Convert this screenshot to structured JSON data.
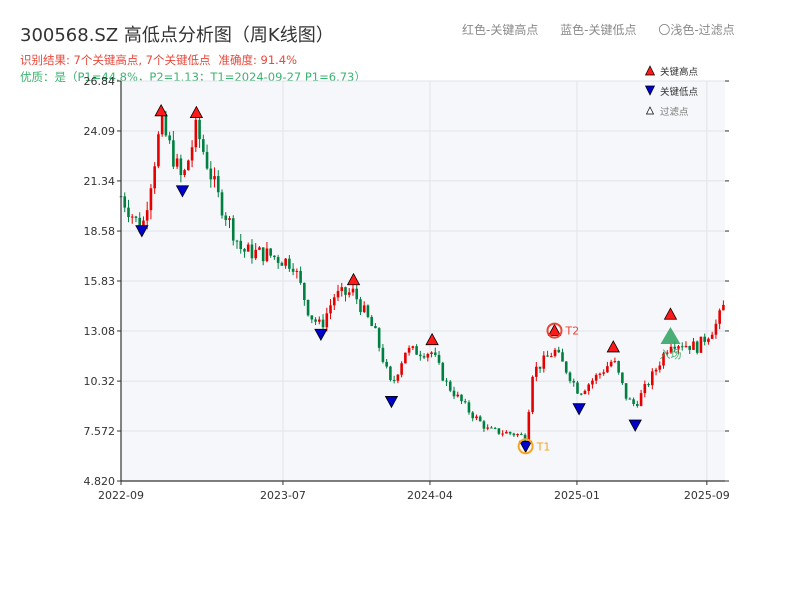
{
  "header": {
    "title": "300568.SZ 高低点分析图（周K线图）",
    "legend_red": "红色-关键高点",
    "legend_blue": "蓝色-关键低点",
    "legend_light": "〇浅色-过滤点",
    "result_text": "识别结果: 7个关键高点, 7个关键低点",
    "accuracy_text": "准确度: 91.4%",
    "quality_text": "优质：是（P1=44.8%，P2=1.13；T1=2024-09-27 P1=6.73）"
  },
  "chart_legend": {
    "high": "关键高点",
    "low": "关键低点",
    "filtered": "过滤点"
  },
  "colors": {
    "up_candle": "#e60000",
    "down_candle": "#008040",
    "high_marker": "#ff1a1a",
    "low_marker": "#0000cc",
    "t1": "#f5a623",
    "t2": "#e8473a",
    "entry": "#2ca25f",
    "plot_bg": "#f5f7fa",
    "grid": "#e0e3e8"
  },
  "chart_data": {
    "type": "candlestick",
    "title": "300568.SZ 高低点分析图（周K线图）",
    "y_ticks": [
      "4.820",
      "7.572",
      "10.32",
      "13.08",
      "15.83",
      "18.58",
      "21.34",
      "24.09",
      "26.84"
    ],
    "ylim": [
      4.82,
      26.84
    ],
    "x_ticks": [
      "2022-09",
      "2023-07",
      "2024-04",
      "2025-01",
      "2025-09"
    ],
    "x_range": [
      "2022-09-01",
      "2025-10-05"
    ],
    "grid": true,
    "legend_position": "top-right",
    "series": [
      {
        "name": "关键高点",
        "marker": "triangle-up",
        "points": [
          {
            "date": "2022-11-15",
            "value": 25.2
          },
          {
            "date": "2023-01-20",
            "value": 25.1
          },
          {
            "date": "2023-11-10",
            "value": 15.9
          },
          {
            "date": "2024-04-05",
            "value": 12.6
          },
          {
            "date": "2024-11-20",
            "value": 13.1
          },
          {
            "date": "2025-03-10",
            "value": 12.2
          },
          {
            "date": "2025-06-25",
            "value": 14.0
          }
        ]
      },
      {
        "name": "关键低点",
        "marker": "triangle-down",
        "points": [
          {
            "date": "2022-10-10",
            "value": 18.6
          },
          {
            "date": "2022-12-25",
            "value": 20.8
          },
          {
            "date": "2023-09-10",
            "value": 12.9
          },
          {
            "date": "2024-01-20",
            "value": 9.2
          },
          {
            "date": "2024-09-27",
            "value": 6.73
          },
          {
            "date": "2025-01-05",
            "value": 8.8
          },
          {
            "date": "2025-04-20",
            "value": 7.9
          }
        ]
      }
    ],
    "annotations": [
      {
        "label": "T1",
        "date": "2024-09-27",
        "value": 6.73
      },
      {
        "label": "T2",
        "date": "2024-11-20",
        "value": 13.1
      },
      {
        "label": "入场",
        "date": "2025-06-25",
        "value": 12.8
      }
    ],
    "price_path": [
      {
        "date": "2022-09-01",
        "value": 20.5
      },
      {
        "date": "2022-10-10",
        "value": 18.6
      },
      {
        "date": "2022-11-15",
        "value": 24.5
      },
      {
        "date": "2022-12-25",
        "value": 21.3
      },
      {
        "date": "2023-01-20",
        "value": 24.2
      },
      {
        "date": "2023-03-01",
        "value": 20.5
      },
      {
        "date": "2023-04-15",
        "value": 17.5
      },
      {
        "date": "2023-06-01",
        "value": 17.3
      },
      {
        "date": "2023-07-20",
        "value": 16.8
      },
      {
        "date": "2023-08-20",
        "value": 14.0
      },
      {
        "date": "2023-09-10",
        "value": 13.3
      },
      {
        "date": "2023-10-05",
        "value": 15.0
      },
      {
        "date": "2023-11-10",
        "value": 15.2
      },
      {
        "date": "2023-12-20",
        "value": 13.0
      },
      {
        "date": "2024-01-20",
        "value": 10.0
      },
      {
        "date": "2024-02-15",
        "value": 12.0
      },
      {
        "date": "2024-04-05",
        "value": 11.9
      },
      {
        "date": "2024-05-01",
        "value": 10.2
      },
      {
        "date": "2024-06-15",
        "value": 8.6
      },
      {
        "date": "2024-07-20",
        "value": 7.6
      },
      {
        "date": "2024-09-10",
        "value": 7.4
      },
      {
        "date": "2024-09-27",
        "value": 7.2
      },
      {
        "date": "2024-10-10",
        "value": 10.8
      },
      {
        "date": "2024-11-20",
        "value": 12.0
      },
      {
        "date": "2024-12-15",
        "value": 10.8
      },
      {
        "date": "2025-01-05",
        "value": 9.7
      },
      {
        "date": "2025-02-15",
        "value": 10.8
      },
      {
        "date": "2025-03-10",
        "value": 11.5
      },
      {
        "date": "2025-04-05",
        "value": 9.3
      },
      {
        "date": "2025-04-20",
        "value": 9.0
      },
      {
        "date": "2025-05-20",
        "value": 10.5
      },
      {
        "date": "2025-06-25",
        "value": 12.5
      },
      {
        "date": "2025-08-15",
        "value": 12.2
      },
      {
        "date": "2025-09-20",
        "value": 13.5
      },
      {
        "date": "2025-10-05",
        "value": 14.6
      }
    ]
  }
}
